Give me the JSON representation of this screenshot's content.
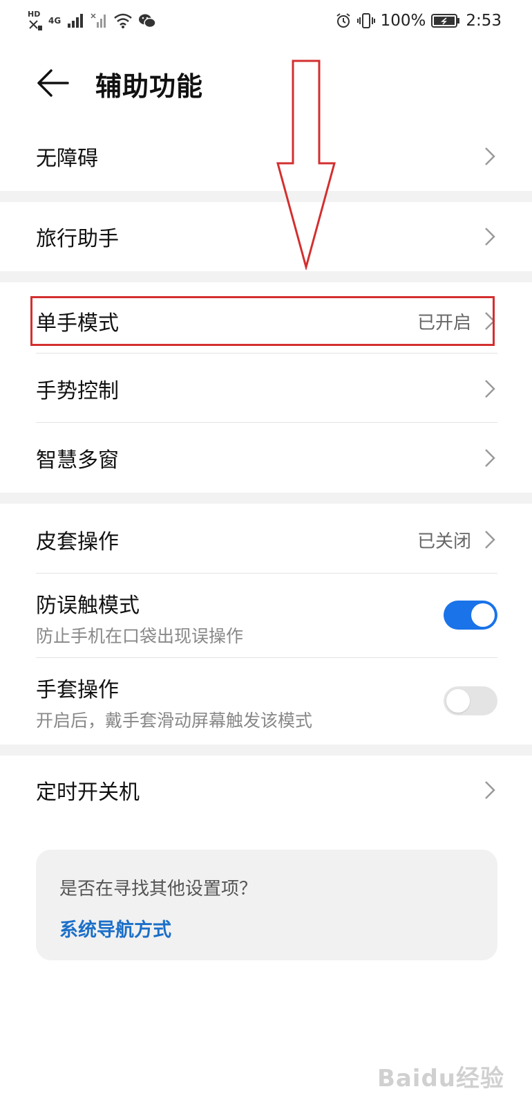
{
  "status_bar": {
    "sim_label": "HD",
    "network": "4G",
    "battery_percent": "100%",
    "time": "2:53"
  },
  "header": {
    "title": "辅助功能"
  },
  "items": {
    "accessibility": {
      "label": "无障碍"
    },
    "travel_assistant": {
      "label": "旅行助手"
    },
    "one_hand_mode": {
      "label": "单手模式",
      "value": "已开启"
    },
    "gesture_control": {
      "label": "手势控制"
    },
    "smart_multi_window": {
      "label": "智慧多窗"
    },
    "cover_operation": {
      "label": "皮套操作",
      "value": "已关闭"
    },
    "accidental_touch": {
      "label": "防误触模式",
      "description": "防止手机在口袋出现误操作",
      "enabled": true
    },
    "glove_mode": {
      "label": "手套操作",
      "description": "开启后，戴手套滑动屏幕触发该模式",
      "enabled": false
    },
    "scheduled_power": {
      "label": "定时开关机"
    }
  },
  "suggestion": {
    "question": "是否在寻找其他设置项？",
    "link": "系统导航方式"
  },
  "watermark": "Baidu经验",
  "colors": {
    "accent": "#1a73e8",
    "link": "#1b6fc8",
    "highlight": "#d32f2f"
  },
  "icons": [
    "back-arrow-icon",
    "chevron-right-icon",
    "alarm-icon",
    "vibrate-icon",
    "battery-icon",
    "wifi-icon",
    "wechat-icon",
    "signal-icon"
  ]
}
